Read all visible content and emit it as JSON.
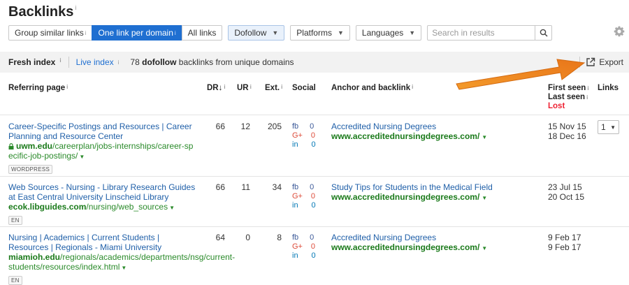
{
  "page": {
    "title": "Backlinks",
    "info": "i"
  },
  "toolbar": {
    "group_similar": "Group similar links",
    "one_per_domain": "One link per domain",
    "all_links": "All links",
    "dofollow": "Dofollow",
    "platforms": "Platforms",
    "languages": "Languages",
    "search_placeholder": "Search in results"
  },
  "index_bar": {
    "fresh": "Fresh index",
    "live": "Live index",
    "count": "78",
    "count_bold": "dofollow",
    "count_suffix": "backlinks from unique domains",
    "export": "Export"
  },
  "table": {
    "headers": {
      "referring_page": "Referring page",
      "dr": "DR",
      "ur": "UR",
      "ext": "Ext.",
      "social": "Social",
      "anchor": "Anchor and backlink",
      "first_seen": "First seen",
      "last_seen": "Last seen",
      "lost": "Lost",
      "links": "Links"
    },
    "rows": [
      {
        "title": "Career-Specific Postings and Resources | Career Planning and Resource Center",
        "url_domain": "uwm.edu",
        "url_path": "/careerplan/jobs-internships/career-specific-job-postings/",
        "tag": "WORDPRESS",
        "dr": "66",
        "ur": "12",
        "ext": "205",
        "fb": "0",
        "gp": "0",
        "in": "0",
        "anchor": "Accredited Nursing Degrees",
        "backlink": "www.accreditednursingdegrees.com/",
        "first_seen": "15 Nov 15",
        "last_seen": "18 Dec 16",
        "links": "1"
      },
      {
        "title": "Web Sources - Nursing - Library Research Guides at East Central University Linscheid Library",
        "url_domain": "ecok.libguides.com",
        "url_path": "/nursing/web_sources",
        "tag": "EN",
        "dr": "66",
        "ur": "11",
        "ext": "34",
        "fb": "0",
        "gp": "0",
        "in": "0",
        "anchor": "Study Tips for Students in the Medical Field",
        "backlink": "www.accreditednursingdegrees.com/",
        "first_seen": "23 Jul 15",
        "last_seen": "20 Oct 15"
      },
      {
        "title": "Nursing | Academics | Current Students | Resources | Regionals - Miami University",
        "url_domain": "miamioh.edu",
        "url_path": "/regionals/academics/departments/nsg/current-students/resources/index.html",
        "tag": "EN",
        "dr": "64",
        "ur": "0",
        "ext": "8",
        "fb": "0",
        "gp": "0",
        "in": "0",
        "anchor": "Accredited Nursing Degrees",
        "backlink": "www.accreditednursingdegrees.com/",
        "first_seen": "9 Feb 17",
        "last_seen": "9 Feb 17"
      }
    ]
  },
  "social_labels": {
    "fb": "fb",
    "gp": "G+",
    "in": "in"
  },
  "colors": {
    "accent": "#1f6fd1",
    "green": "#2a8a2a",
    "lost": "#e23333",
    "arrow": "#f08a1c"
  }
}
